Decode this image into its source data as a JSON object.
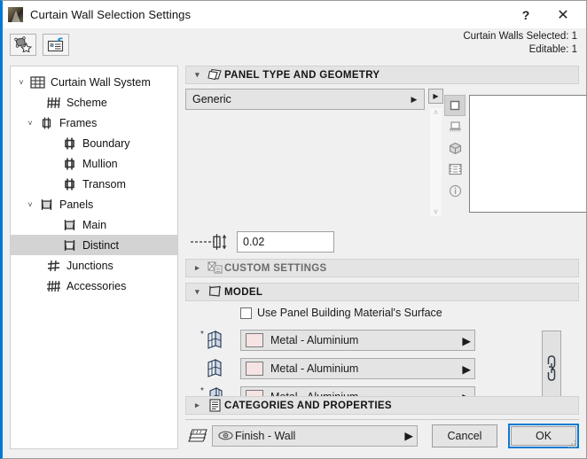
{
  "window": {
    "title": "Curtain Wall Selection Settings",
    "logo_icon": "archicad-logo-icon",
    "help_label": "?",
    "close_label": "✕"
  },
  "toolbar": {
    "favorites_icon": "favorites-star-icon",
    "transfer_icon": "settings-transfer-icon",
    "selection_line1": "Curtain Walls Selected: 1",
    "selection_line2": "Editable: 1"
  },
  "tree": {
    "items": [
      {
        "label": "Curtain Wall System",
        "icon": "curtain-wall-grid-icon",
        "indent": 0,
        "twisty": "˅",
        "selected": false
      },
      {
        "label": "Scheme",
        "icon": "scheme-grid-icon",
        "indent": 1,
        "twisty": "",
        "selected": false
      },
      {
        "label": "Frames",
        "icon": "frames-icon",
        "indent": 1,
        "twisty": "˅",
        "selected": false
      },
      {
        "label": "Boundary",
        "icon": "boundary-frame-icon",
        "indent": 2,
        "twisty": "",
        "selected": false
      },
      {
        "label": "Mullion",
        "icon": "mullion-frame-icon",
        "indent": 2,
        "twisty": "",
        "selected": false
      },
      {
        "label": "Transom",
        "icon": "transom-frame-icon",
        "indent": 2,
        "twisty": "",
        "selected": false
      },
      {
        "label": "Panels",
        "icon": "panels-icon",
        "indent": 1,
        "twisty": "˅",
        "selected": false
      },
      {
        "label": "Main",
        "icon": "main-panel-icon",
        "indent": 2,
        "twisty": "",
        "selected": false
      },
      {
        "label": "Distinct",
        "icon": "distinct-panel-icon",
        "indent": 2,
        "twisty": "",
        "selected": true
      },
      {
        "label": "Junctions",
        "icon": "junctions-icon",
        "indent": 1,
        "twisty": "",
        "selected": false
      },
      {
        "label": "Accessories",
        "icon": "accessories-icon",
        "indent": 1,
        "twisty": "",
        "selected": false
      }
    ]
  },
  "panel_type_section": {
    "title": "PANEL TYPE AND GEOMETRY",
    "icon": "panel-stack-icon",
    "twisty": "▾",
    "type_value": "Generic",
    "type_arrow": "▶",
    "expand_icon": "expand-arrow-icon",
    "scroll_up": "˄",
    "scroll_down": "˅",
    "view_icons": [
      {
        "name": "2d-symbol-view-icon",
        "active": true
      },
      {
        "name": "elevation-view-icon",
        "active": false
      },
      {
        "name": "3d-view-icon",
        "active": false
      },
      {
        "name": "list-view-icon",
        "active": false
      },
      {
        "name": "info-view-icon",
        "active": false
      }
    ],
    "preview_name": "panel-preview-canvas"
  },
  "thickness": {
    "icon": "panel-thickness-icon",
    "value": "0.02"
  },
  "custom_settings_section": {
    "title": "CUSTOM SETTINGS",
    "icon": "custom-settings-icon",
    "twisty": "▸"
  },
  "model_section": {
    "title": "MODEL",
    "icon": "model-outline-icon",
    "twisty": "▾",
    "checkbox_label": "Use Panel Building Material's Surface",
    "checkbox_checked": false,
    "link_icon": "link-surfaces-icon",
    "swatch_color": "#f6e3e3",
    "materials": [
      {
        "icon": "outside-surface-icon",
        "value": "Metal - Aluminium",
        "arrow": "▶"
      },
      {
        "icon": "edge-surface-icon",
        "value": "Metal - Aluminium",
        "arrow": "▶"
      },
      {
        "icon": "inside-surface-icon",
        "value": "Metal - Aluminium",
        "arrow": "▶"
      }
    ]
  },
  "categories_section": {
    "title": "CATEGORIES AND PROPERTIES",
    "icon": "categories-list-icon",
    "twisty": "▸"
  },
  "footer": {
    "layer_icon": "layers-stack-icon",
    "eye_icon": "eye-visibility-icon",
    "layer_value": "Finish - Wall",
    "layer_arrow": "▶",
    "cancel_label": "Cancel",
    "ok_label": "OK",
    "resize_grip_icon": "resize-grip-icon"
  },
  "colors": {
    "accent": "#0078d7",
    "ok_focus": "#0a7ad3",
    "panel_bg": "#f0f0f0",
    "section_header_bg": "#e4e4e4",
    "selection_bg": "#d3d3d3"
  }
}
